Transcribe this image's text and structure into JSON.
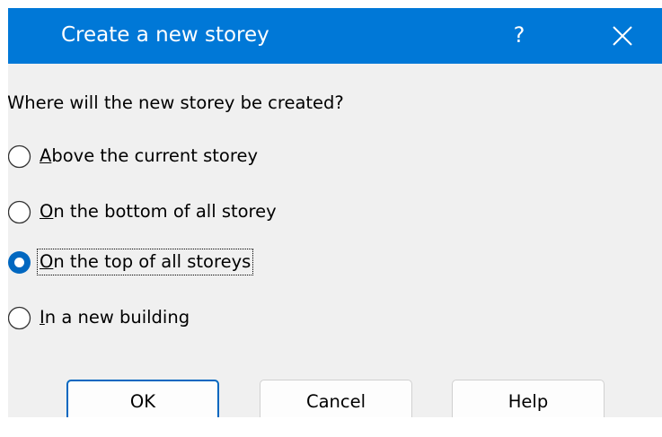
{
  "dialog": {
    "title": "Create a new storey",
    "help_glyph": "?",
    "close_icon": "close-icon",
    "accent_color": "#0078d7"
  },
  "prompt": "Where will the new storey be created?",
  "options": [
    {
      "accel": "A",
      "rest": "bove the current storey",
      "checked": false
    },
    {
      "accel": "O",
      "rest": "n the bottom of all storey",
      "checked": false
    },
    {
      "accel": "O",
      "rest": "n the top of all storeys",
      "checked": true
    },
    {
      "accel": "I",
      "rest": "n a new building",
      "checked": false
    }
  ],
  "buttons": {
    "ok": "OK",
    "cancel": "Cancel",
    "help": "Help"
  }
}
